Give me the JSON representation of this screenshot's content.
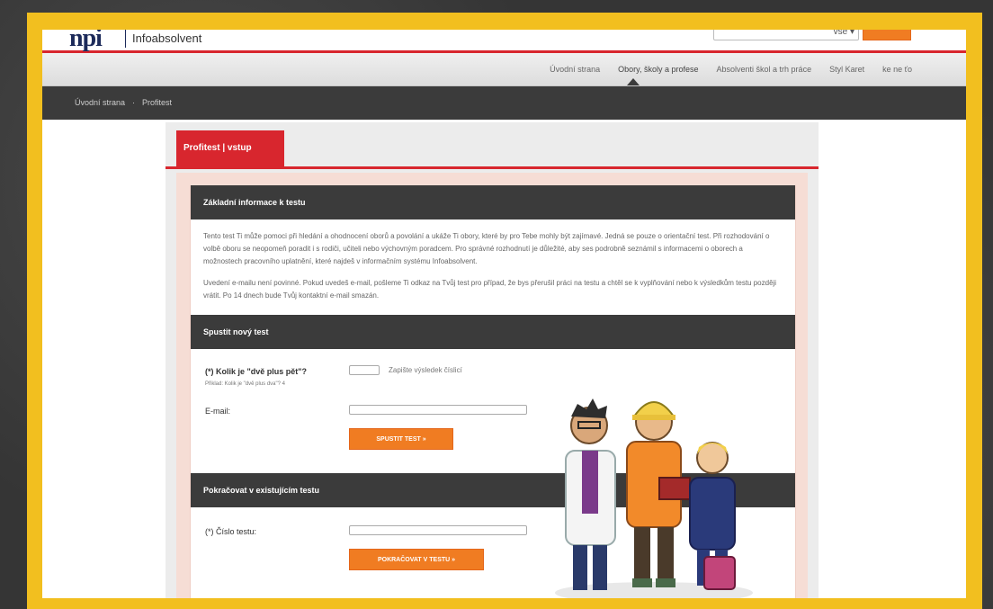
{
  "header": {
    "logo": "npi",
    "logo_sub": "Infoabsolvent",
    "search_select": "vše"
  },
  "nav": {
    "items": [
      {
        "label": "Úvodní strana"
      },
      {
        "label": "Obory, školy a profese"
      },
      {
        "label": "Absolventi škol a trh práce"
      },
      {
        "label": "Styl Karet"
      },
      {
        "label": "ke ne ťo"
      }
    ]
  },
  "breadcrumb": [
    "Úvodní strana",
    "Profitest"
  ],
  "tab": {
    "label": "Profitest | vstup"
  },
  "sections": {
    "info_title": "Základní informace k testu",
    "info_p1": "Tento test Ti může pomoci při hledání a ohodnocení oborů a povolání a ukáže Ti obory, které by pro Tebe mohly být zajímavé. Jedná se pouze o orientační test. Při rozhodování o volbě oboru se neopomeň poradit i s rodiči, učiteli nebo výchovným poradcem. Pro správné rozhodnutí je důležité, aby ses podrobně seznámil s informacemi o oborech a možnostech pracovního uplatnění, které najdeš v informačním systému Infoabsolvent.",
    "info_p2": "Uvedení e-mailu není povinné. Pokud uvedeš e-mail, pošleme Ti odkaz na Tvůj test pro případ, že bys přerušil práci na testu a chtěl se k vyplňování nebo k výsledkům testu později vrátit. Po 14 dnech bude Tvůj kontaktní e-mail smazán.",
    "new_title": "Spustit nový test",
    "captcha_label": "(*) Kolik je \"dvě plus pět\"?",
    "captcha_hint": "Přiklad: Kolik je \"dvě plus dva\"? 4",
    "captcha_right": "Zapište výsledek číslicí",
    "email_label": "E-mail:",
    "start_btn": "SPUSTIT TEST »",
    "cont_title": "Pokračovat v existujícím testu",
    "test_no_label": "(*) Číslo testu:",
    "cont_btn": "POKRAČOVAT V TESTU »"
  },
  "colors": {
    "accent": "#d8262e",
    "button": "#f07c22",
    "frame": "#f2bf1f",
    "dark": "#3b3b3b"
  }
}
